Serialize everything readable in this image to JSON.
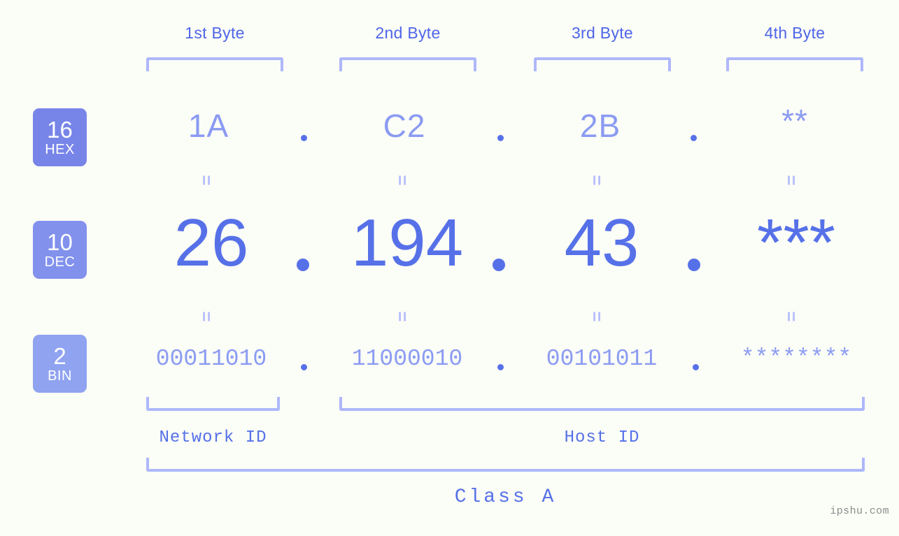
{
  "background_color": "#fbfdf7",
  "colors": {
    "accent_strong": "#5671e8",
    "accent_mid": "#8b9bf2",
    "bracket": "#aeb8fb",
    "equals": "#b6c0fb",
    "watermark": "#8c8c8c",
    "badge_hex": "#7785e8",
    "badge_dec": "#8191ec",
    "badge_bin": "#8fa3f0"
  },
  "bases": [
    {
      "number": "16",
      "name": "HEX"
    },
    {
      "number": "10",
      "name": "DEC"
    },
    {
      "number": "2",
      "name": "BIN"
    }
  ],
  "byte_headers": [
    {
      "label": "1st Byte"
    },
    {
      "label": "2nd Byte"
    },
    {
      "label": "3rd Byte"
    },
    {
      "label": "4th Byte"
    }
  ],
  "rows": {
    "hex": {
      "values": [
        "1A",
        "C2",
        "2B",
        "**"
      ],
      "separator": "."
    },
    "dec": {
      "values": [
        "26",
        "194",
        "43",
        "***"
      ],
      "separator": "."
    },
    "bin": {
      "values": [
        "00011010",
        "11000010",
        "00101011",
        "********"
      ],
      "separator": "."
    }
  },
  "equals_symbol": "=",
  "segments": {
    "network_id": "Network ID",
    "host_id": "Host ID"
  },
  "class_label": "Class A",
  "watermark": "ipshu.com"
}
